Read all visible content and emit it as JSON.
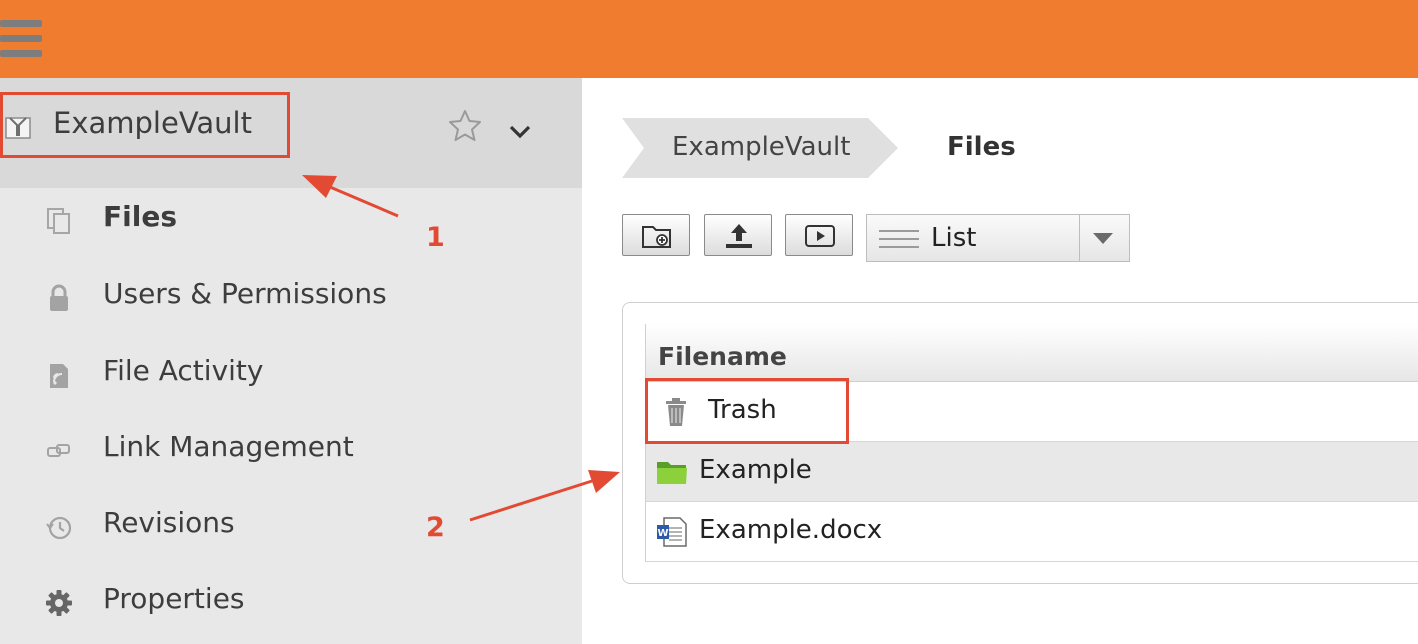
{
  "sidebar": {
    "vault_name": "ExampleVault",
    "items": [
      {
        "label": "Files",
        "icon": "files-icon",
        "active": true
      },
      {
        "label": "Users & Permissions",
        "icon": "lock-icon"
      },
      {
        "label": "File Activity",
        "icon": "activity-icon"
      },
      {
        "label": "Link Management",
        "icon": "link-icon"
      },
      {
        "label": "Revisions",
        "icon": "clock-icon"
      },
      {
        "label": "Properties",
        "icon": "gear-icon"
      }
    ]
  },
  "breadcrumb": {
    "vault": "ExampleVault",
    "current": "Files"
  },
  "toolbar": {
    "buttons": [
      "new-folder-icon",
      "upload-icon",
      "play-icon"
    ],
    "view": "List"
  },
  "table": {
    "header": "Filename",
    "rows": [
      {
        "name": "Trash",
        "icon": "trash-icon"
      },
      {
        "name": "Example",
        "icon": "folder-icon"
      },
      {
        "name": "Example.docx",
        "icon": "word-doc-icon"
      }
    ]
  },
  "annotations": {
    "marker_1": "1",
    "marker_2": "2"
  },
  "colors": {
    "topbar": "#f07c30",
    "annotation": "#e24a34",
    "sidebar": "#e8e8e8"
  }
}
